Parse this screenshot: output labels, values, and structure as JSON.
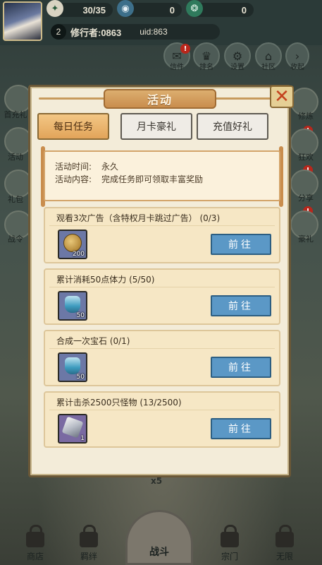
{
  "top_bar": {
    "stamina": "30/35",
    "currency_a": "0",
    "currency_b": "0",
    "level": "2",
    "player_name": "修行者:0863",
    "uid": "uid:863"
  },
  "top_menu": [
    {
      "label": "信件",
      "icon": "mail-icon",
      "alert": "!"
    },
    {
      "label": "排名",
      "icon": "rank-icon",
      "alert": ""
    },
    {
      "label": "设置",
      "icon": "gear-icon",
      "alert": ""
    },
    {
      "label": "社区",
      "icon": "community-icon",
      "alert": ""
    },
    {
      "label": "收起",
      "icon": "chevron-right-icon",
      "alert": ""
    }
  ],
  "side_left": [
    "首充礼",
    "活动",
    "礼包",
    "战令"
  ],
  "side_right": [
    "修炼",
    "狂欢",
    "分享",
    "豪礼"
  ],
  "bottom_nav": {
    "item1": "商店",
    "item2": "羁绊",
    "battle": "战斗",
    "item4": "宗门",
    "item5": "无限",
    "multiplier": "x5"
  },
  "dialog": {
    "title": "活动",
    "close_symbol": "✕",
    "tabs": [
      "每日任务",
      "月卡豪礼",
      "充值好礼"
    ],
    "active_tab": 0,
    "info": {
      "time_key": "活动时间:",
      "time_value": "永久",
      "content_key": "活动内容:",
      "content_value": "完成任务即可领取丰富奖励"
    },
    "tasks": [
      {
        "title": "观看3次广告（含特权月卡跳过广告） (0/3)",
        "reward_icon": "coin-icon",
        "reward_count": "200",
        "button": "前往"
      },
      {
        "title": "累计消耗50点体力 (5/50)",
        "reward_icon": "potion-icon",
        "reward_count": "50",
        "button": "前往"
      },
      {
        "title": "合成一次宝石 (0/1)",
        "reward_icon": "potion-icon",
        "reward_count": "50",
        "button": "前往"
      },
      {
        "title": "累计击杀2500只怪物 (13/2500)",
        "reward_icon": "crystal-icon",
        "reward_count": "1",
        "button": "前往"
      }
    ]
  },
  "colors": {
    "dialog_bg": "#f3ecd9",
    "tab_active": "#e2a45a",
    "go_button": "#5b98c6",
    "alert_red": "#b9261b"
  }
}
